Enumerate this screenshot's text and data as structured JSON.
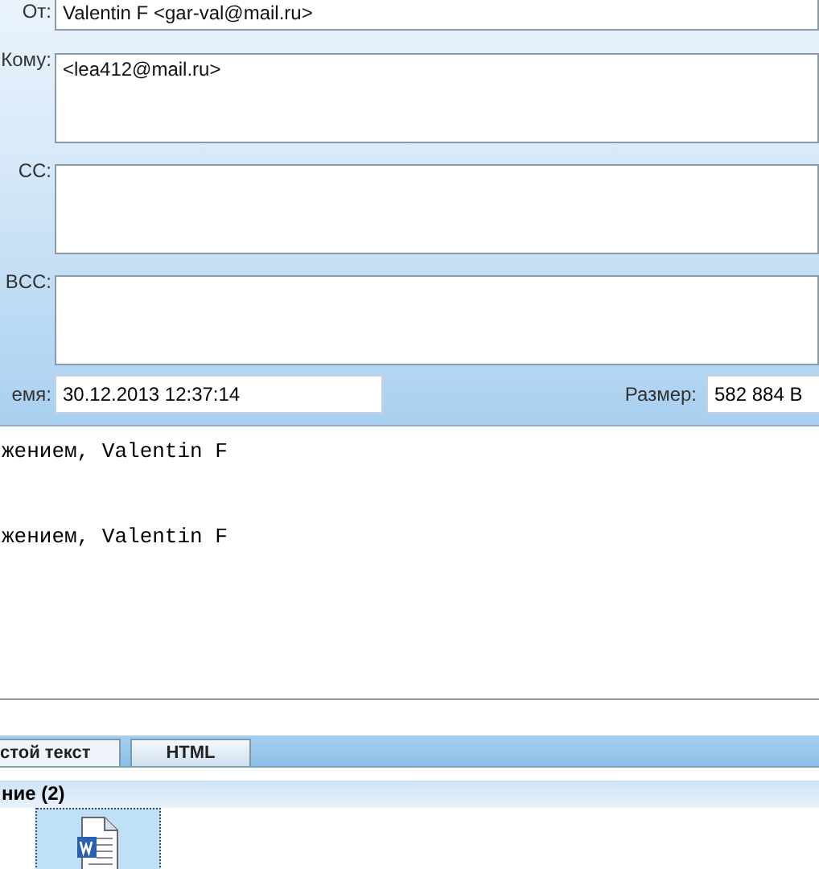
{
  "header": {
    "fields": [
      {
        "label": "От:",
        "value": "Valentin F <gar-val@mail.ru>",
        "kind": "line"
      },
      {
        "label": "Кому:",
        "value": "<lea412@mail.ru>",
        "kind": "box"
      },
      {
        "label": "CC:",
        "kind": "box"
      },
      {
        "label": "BCC:",
        "kind": "box"
      }
    ],
    "time": {
      "label": "емя:",
      "value": "30.12.2013 12:37:14"
    },
    "size": {
      "label": "Размер:",
      "value": "582 884 B"
    }
  },
  "body": [
    "жением, Valentin F",
    "жением, Valentin F"
  ],
  "tabs": [
    {
      "label": "стой текст",
      "selected": true
    },
    {
      "label": "HTML",
      "selected": false
    }
  ],
  "attachments": {
    "title": "ние (2)",
    "items": [
      {
        "kind": "word",
        "selected": true
      }
    ]
  }
}
